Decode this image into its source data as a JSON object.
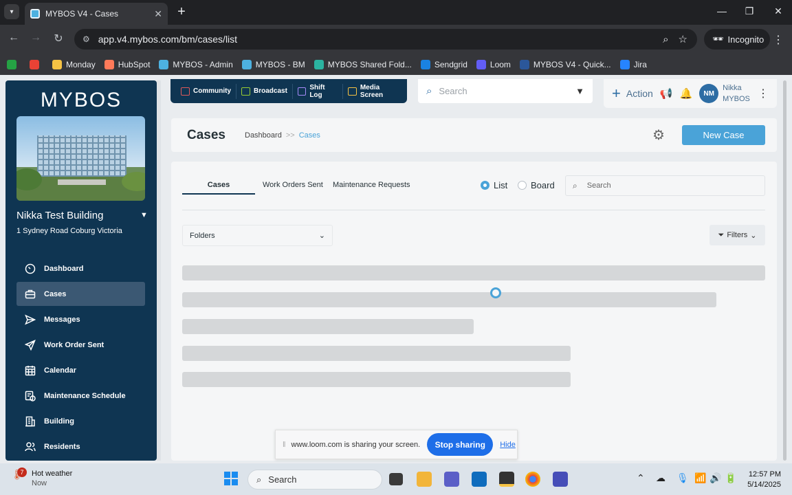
{
  "browser": {
    "tab_title": "MYBOS V4 - Cases",
    "url": "app.v4.mybos.com/bm/cases/list",
    "incognito_label": "Incognito",
    "bookmarks": [
      {
        "label": "",
        "color": "#25a244"
      },
      {
        "label": "",
        "color": "#e94235"
      },
      {
        "label": "Monday",
        "color": "#f6c344"
      },
      {
        "label": "HubSpot",
        "color": "#ff7a59"
      },
      {
        "label": "MYBOS - Admin",
        "color": "#4db1e0"
      },
      {
        "label": "MYBOS - BM",
        "color": "#4db1e0"
      },
      {
        "label": "MYBOS Shared Fold...",
        "color": "#2bb3a0"
      },
      {
        "label": "Sendgrid",
        "color": "#1a82e2"
      },
      {
        "label": "Loom",
        "color": "#625df5"
      },
      {
        "label": "MYBOS V4 - Quick...",
        "color": "#2b579a"
      },
      {
        "label": "Jira",
        "color": "#2684ff"
      }
    ]
  },
  "sidebar": {
    "logo": "MYBOS",
    "building_name": "Nikka Test Building",
    "building_address": "1 Sydney Road Coburg Victoria",
    "items": [
      {
        "label": "Dashboard",
        "icon": "dashboard-icon"
      },
      {
        "label": "Cases",
        "icon": "briefcase-icon"
      },
      {
        "label": "Messages",
        "icon": "send-icon"
      },
      {
        "label": "Work Order Sent",
        "icon": "paper-plane-icon"
      },
      {
        "label": "Calendar",
        "icon": "calendar-icon"
      },
      {
        "label": "Maintenance Schedule",
        "icon": "schedule-icon"
      },
      {
        "label": "Building",
        "icon": "building-icon"
      },
      {
        "label": "Residents",
        "icon": "residents-icon"
      }
    ]
  },
  "topbar": {
    "quicknav": [
      {
        "label": "Community",
        "color": "#e05a5a"
      },
      {
        "label": "Broadcast",
        "color": "#9acd32"
      },
      {
        "label": "Shift Log",
        "color": "#a78bfa"
      },
      {
        "label": "Media Screen",
        "color": "#f6c344"
      }
    ],
    "search_placeholder": "Search",
    "action_label": "Action",
    "user_initials": "NM",
    "user_first": "Nikka",
    "user_last": "MYBOS"
  },
  "header": {
    "title": "Cases",
    "breadcrumb_home": "Dashboard",
    "breadcrumb_sep": ">>",
    "breadcrumb_current": "Cases",
    "new_case_label": "New Case"
  },
  "main": {
    "tabs": [
      "Cases",
      "Work Orders Sent",
      "Maintenance Requests"
    ],
    "view_list": "List",
    "view_board": "Board",
    "search_placeholder": "Search",
    "folders_label": "Folders",
    "filters_label": "Filters"
  },
  "loom": {
    "message": "www.loom.com is sharing your screen.",
    "stop_label": "Stop sharing",
    "hide_label": "Hide"
  },
  "taskbar": {
    "weather_badge": "7",
    "weather_title": "Hot weather",
    "weather_sub": "Now",
    "search_label": "Search",
    "time": "12:57 PM",
    "date": "5/14/2025"
  }
}
